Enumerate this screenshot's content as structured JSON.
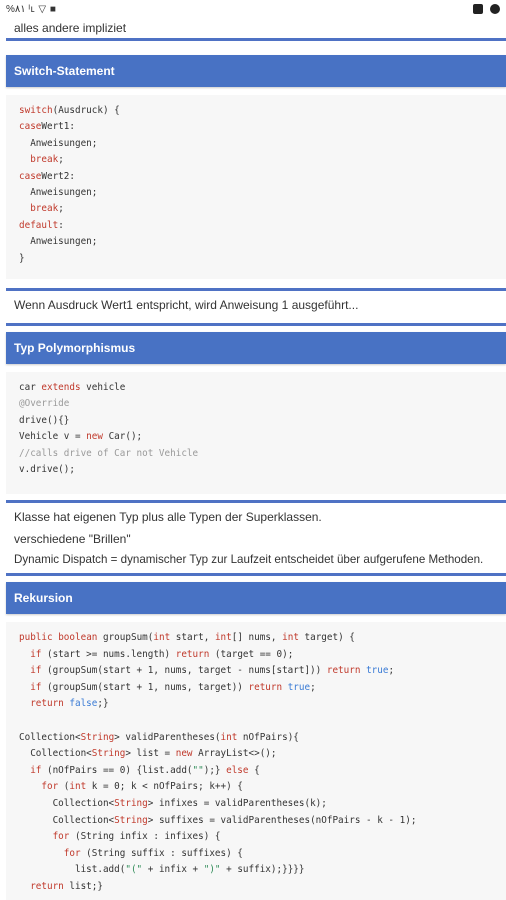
{
  "status_bar": {
    "left_text": "%٨١ ᴵʟ ▽ ■"
  },
  "top_card": {
    "text": "alles andere impliziet"
  },
  "switch_section": {
    "title": "Switch-Statement",
    "code": [
      [
        [
          "kw",
          "switch"
        ],
        [
          "",
          "(Ausdruck) {"
        ]
      ],
      [
        [
          "kw",
          "case"
        ],
        [
          "",
          "Wert1:"
        ]
      ],
      [
        [
          "",
          "  Anweisungen;"
        ]
      ],
      [
        [
          "kw",
          "  break"
        ],
        [
          "",
          ";"
        ]
      ],
      [
        [
          "kw",
          "case"
        ],
        [
          "",
          "Wert2:"
        ]
      ],
      [
        [
          "",
          "  Anweisungen;"
        ]
      ],
      [
        [
          "kw",
          "  break"
        ],
        [
          "",
          ";"
        ]
      ],
      [
        [
          "kw",
          "default"
        ],
        [
          "",
          ":"
        ]
      ],
      [
        [
          "",
          "  Anweisungen;"
        ]
      ],
      [
        [
          "",
          "}"
        ]
      ]
    ],
    "note": "Wenn Ausdruck Wert1 entspricht, wird Anweisung 1 ausgeführt..."
  },
  "poly_section": {
    "title": "Typ Polymorphismus",
    "code": [
      [
        [
          "",
          "car "
        ],
        [
          "kw",
          "extends"
        ],
        [
          "",
          " vehicle"
        ]
      ],
      [
        [
          "cm",
          "@Override"
        ]
      ],
      [
        [
          "",
          "drive(){}"
        ]
      ],
      [
        [
          "",
          "Vehicle v = "
        ],
        [
          "kw",
          "new"
        ],
        [
          "",
          " Car();"
        ]
      ],
      [
        [
          "cm",
          "//calls drive of Car not Vehicle"
        ]
      ],
      [
        [
          "",
          "v.drive();"
        ]
      ]
    ],
    "notes": [
      "Klasse hat eigenen Typ plus alle Typen der Superklassen.",
      "verschiedene \"Brillen\"",
      "Dynamic Dispatch = dynamischer Typ zur Laufzeit entscheidet über aufgerufene Methoden."
    ]
  },
  "rekursion_section": {
    "title": "Rekursion",
    "code": [
      [
        [
          "kw",
          "public"
        ],
        [
          "",
          " "
        ],
        [
          "kw",
          "boolean"
        ],
        [
          "",
          " groupSum("
        ],
        [
          "kw",
          "int"
        ],
        [
          "",
          " start, "
        ],
        [
          "kw",
          "int"
        ],
        [
          "",
          "[] nums, "
        ],
        [
          "kw",
          "int"
        ],
        [
          "",
          " target) {"
        ]
      ],
      [
        [
          "kw",
          "  if"
        ],
        [
          "",
          " (start >= nums.length) "
        ],
        [
          "kw",
          "return"
        ],
        [
          "",
          " (target == 0);"
        ]
      ],
      [
        [
          "kw",
          "  if"
        ],
        [
          "",
          " (groupSum(start + 1, nums, target - nums[start])) "
        ],
        [
          "kw",
          "return"
        ],
        [
          "",
          " "
        ],
        [
          "bl",
          "true"
        ],
        [
          "",
          ";"
        ]
      ],
      [
        [
          "kw",
          "  if"
        ],
        [
          "",
          " (groupSum(start + 1, nums, target)) "
        ],
        [
          "kw",
          "return"
        ],
        [
          "",
          " "
        ],
        [
          "bl",
          "true"
        ],
        [
          "",
          ";"
        ]
      ],
      [
        [
          "kw",
          "  return"
        ],
        [
          "",
          " "
        ],
        [
          "bl",
          "false"
        ],
        [
          "",
          ";}"
        ]
      ],
      [
        [
          "",
          ""
        ]
      ],
      [
        [
          "",
          "Collection<"
        ],
        [
          "tp",
          "String"
        ],
        [
          "",
          "> validParentheses("
        ],
        [
          "kw",
          "int"
        ],
        [
          "",
          " nOfPairs){"
        ]
      ],
      [
        [
          "",
          "  Collection<"
        ],
        [
          "tp",
          "String"
        ],
        [
          "",
          "> list = "
        ],
        [
          "kw",
          "new"
        ],
        [
          "",
          " ArrayList<>();"
        ]
      ],
      [
        [
          "kw",
          "  if"
        ],
        [
          "",
          " (nOfPairs == 0) {list.add("
        ],
        [
          "str",
          "\"\""
        ],
        [
          "",
          ");} "
        ],
        [
          "kw",
          "else"
        ],
        [
          "",
          " {"
        ]
      ],
      [
        [
          "kw",
          "    for"
        ],
        [
          "",
          " ("
        ],
        [
          "kw",
          "int"
        ],
        [
          "",
          " k = 0; k < nOfPairs; k++) {"
        ]
      ],
      [
        [
          "",
          "      Collection<"
        ],
        [
          "tp",
          "String"
        ],
        [
          "",
          "> infixes = validParentheses(k);"
        ]
      ],
      [
        [
          "",
          "      Collection<"
        ],
        [
          "tp",
          "String"
        ],
        [
          "",
          "> suffixes = validParentheses(nOfPairs - k - 1);"
        ]
      ],
      [
        [
          "kw",
          "      for"
        ],
        [
          "",
          " (String infix : infixes) {"
        ]
      ],
      [
        [
          "kw",
          "        for"
        ],
        [
          "",
          " (String suffix : suffixes) {"
        ]
      ],
      [
        [
          "",
          "          list.add("
        ],
        [
          "str",
          "\"(\""
        ],
        [
          "",
          " + infix + "
        ],
        [
          "str",
          "\")\""
        ],
        [
          "",
          " + suffix);}}}}"
        ]
      ],
      [
        [
          "kw",
          "  return"
        ],
        [
          "",
          " list;}"
        ]
      ]
    ]
  }
}
